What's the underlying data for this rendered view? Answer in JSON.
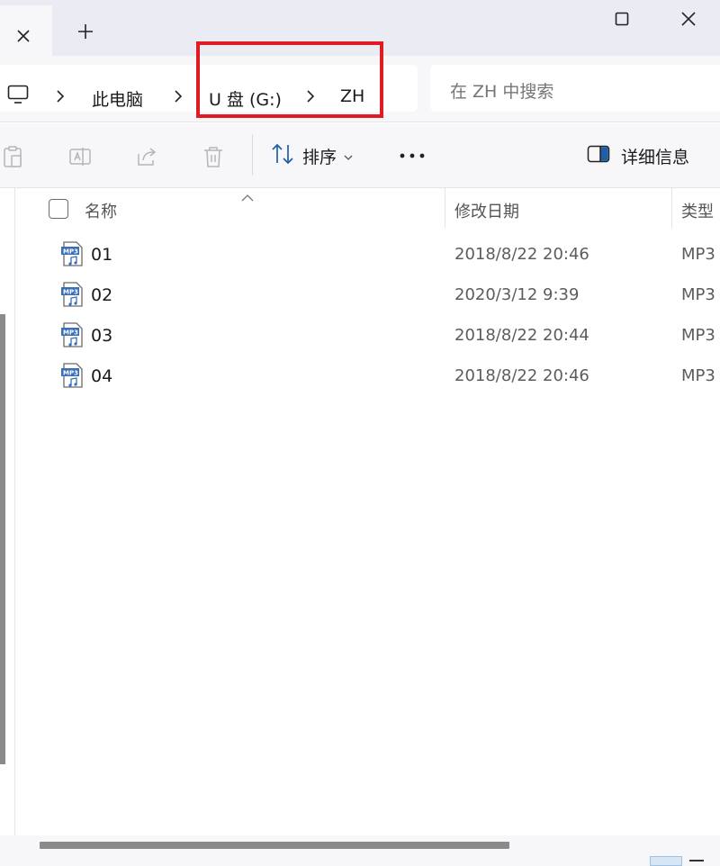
{
  "titlebar": {
    "tab_close_icon": "close-icon",
    "new_tab_icon": "plus-icon",
    "window_buttons": [
      "maximize-icon",
      "close-icon"
    ]
  },
  "address": {
    "computer_icon": "monitor-icon",
    "crumbs": [
      "此电脑",
      "U 盘 (G:)",
      "ZH"
    ],
    "highlight_color": "#e11b22"
  },
  "search": {
    "placeholder": "在 ZH 中搜索"
  },
  "commandbar": {
    "icons": [
      "paste-icon",
      "rename-icon",
      "share-icon",
      "delete-icon"
    ],
    "sort_label": "排序",
    "more_icon": "more-icon",
    "details_label": "详细信息"
  },
  "filelist": {
    "columns": {
      "name": "名称",
      "date": "修改日期",
      "type": "类型"
    },
    "files": [
      {
        "name": "01",
        "date": "2018/8/22 20:46",
        "type": "MP3"
      },
      {
        "name": "02",
        "date": "2020/3/12 9:39",
        "type": "MP3"
      },
      {
        "name": "03",
        "date": "2018/8/22 20:44",
        "type": "MP3"
      },
      {
        "name": "04",
        "date": "2018/8/22 20:46",
        "type": "MP3"
      }
    ]
  }
}
